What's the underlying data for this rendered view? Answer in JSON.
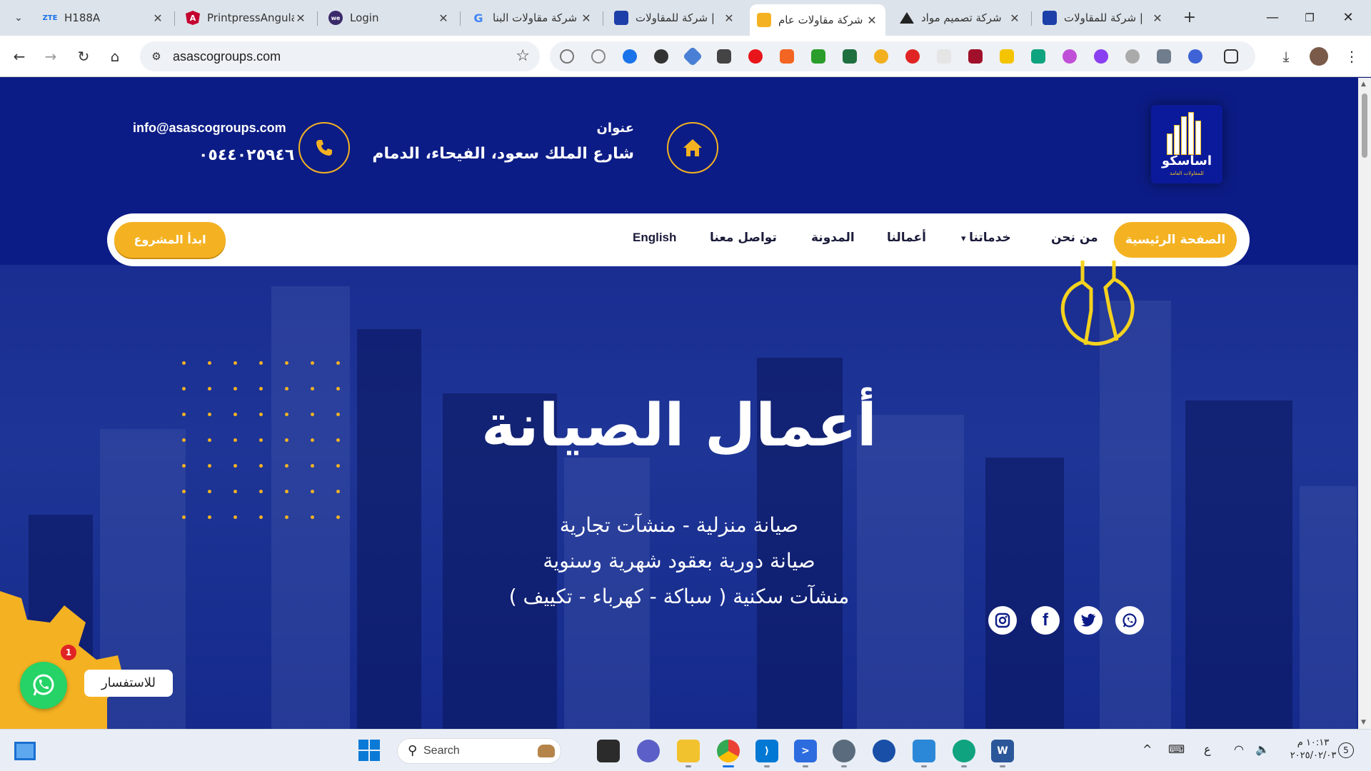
{
  "browser": {
    "tabs": [
      {
        "title": "H188A",
        "favicon": "ZTE",
        "active": false
      },
      {
        "title": "PrintpressAngula",
        "favicon": "angular-icon",
        "active": false
      },
      {
        "title": "Login",
        "favicon": "web-icon",
        "active": false
      },
      {
        "title": "شركة مقاولات البنا",
        "favicon": "google-icon",
        "active": false
      },
      {
        "title": "شركة للمقاولات |",
        "favicon": "site-icon",
        "active": false
      },
      {
        "title": "شركة مقاولات عام",
        "favicon": "site-icon",
        "active": true
      },
      {
        "title": "شركة تصميم مواد",
        "favicon": "site-icon",
        "active": false
      },
      {
        "title": "شركة للمقاولات |",
        "favicon": "site-icon",
        "active": false
      }
    ],
    "url": "asascogroups.com"
  },
  "site": {
    "logo_text": "اساسكو",
    "logo_sub": "للمقاولات العامة",
    "address_label": "عنوان",
    "address": "شارع الملك سعود، الفيحاء، الدمام",
    "email": "info@asascogroups.com",
    "phone": "٠٥٤٤٠٢٥٩٤٦",
    "nav": {
      "home": "الصفحة الرئيسية",
      "about": "من نحن",
      "services": "خدماتنا",
      "works": "أعمالنا",
      "blog": "المدونة",
      "contact": "تواصل معنا",
      "english": "English",
      "cta": "ابدأ المشروع"
    },
    "hero": {
      "title": "أعمال الصيانة",
      "lines": [
        "صيانة منزلية - منشآت تجارية",
        "صيانة دورية بعقود شهرية وسنوية",
        "منشآت سكنية ( سباكة - كهرباء - تكييف )"
      ]
    },
    "whatsapp": {
      "label": "للاستفسار",
      "badge": "1"
    },
    "colors": {
      "primary": "#0c1c86",
      "accent": "#f4b222"
    }
  },
  "taskbar": {
    "search_placeholder": "Search",
    "language": "ع",
    "time": "١٠:١٣ م",
    "date": "٢٠٢٥/٠٢/٠٣",
    "notifications": "5"
  }
}
